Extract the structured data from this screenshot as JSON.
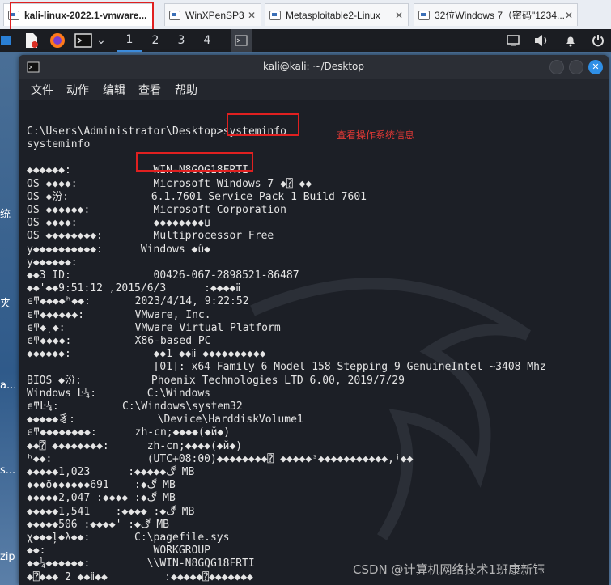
{
  "vmware_tabs": [
    {
      "label": "kali-linux-2022.1-vmware...",
      "active": true
    },
    {
      "label": "WinXPenSP3",
      "active": false
    },
    {
      "label": "Metasploitable2-Linux",
      "active": false
    },
    {
      "label": "32位Windows 7（密码\"1234...",
      "active": false
    }
  ],
  "panel": {
    "workspaces": [
      "1",
      "2",
      "3",
      "4"
    ],
    "active_workspace": "1",
    "icons": [
      "app-menu-icon",
      "file-icon",
      "firefox-icon",
      "terminal-icon",
      "chevron-down-icon",
      "window-icon",
      "volume-icon",
      "bell-icon",
      "power-icon"
    ]
  },
  "desktop_labels": [
    "统",
    "夹",
    "a...",
    "s...",
    "zip"
  ],
  "terminal": {
    "title": "kali@kali: ~/Desktop",
    "menu": [
      "文件",
      "动作",
      "编辑",
      "查看",
      "帮助"
    ],
    "prompt": "C:\\Users\\Administrator\\Desktop>",
    "command": "systeminfo",
    "lines": [
      "systeminfo",
      "",
      "◆◆◆◆◆◆:             WIN-N8GQG18FRTI",
      "OS ◆◆◆◆:            Microsoft Windows 7 ◆⍰ ◆◆",
      "OS ◆汾:             6.1.7601 Service Pack 1 Build 7601",
      "OS ◆◆◆◆◆◆:          Microsoft Corporation",
      "OS ◆◆◆◆:            ◆◆◆◆◆◆◆◆џ",
      "OS ◆◆◆◆◆◆◆◆:        Multiprocessor Free",
      "у◆◆◆◆◆◆◆◆◆◆:      Windows ◆û◆",
      "у◆◆◆◆◆◆:",
      "◆◆3 ID:             00426-067-2898521-86487",
      "◆◆'◆◆9:51:12 ,2015/6/3      :◆◆◆◆ⅱ",
      "ϵͳ◆◆◆◆ʰ◆◆:       2023/4/14, 9:22:52",
      "ϵͳ◆◆◆◆◆◆:        VMware, Inc.",
      "ϵͳ◆ͺ◆:           VMware Virtual Platform",
      "ϵͳ◆◆◆◆:          X86-based PC",
      "◆◆◆◆◆◆:             ◆◆1 ◆◆ⅱ ◆◆◆◆◆◆◆◆◆◆",
      "                    [01]: x64 Family 6 Model 158 Stepping 9 GenuineIntel ~3408 Mhz",
      "BIOS ◆汾:           Phoenix Technologies LTD 6.00, 2019/7/29",
      "Windows Ŀ¼:        C:\\Windows",
      "ϵͳĿ¼:          C:\\Windows\\system32",
      "◆◆◆◆◆豸:             \\Device\\HarddiskVolume1",
      "ϵͳ◆◆◆◆◆◆◆◆:      zh-cn;◆◆◆◆(◆й◆)",
      "◆◆⍰ ◆◆◆◆◆◆◆◆:      zh-cn;◆◆◆◆(◆й◆)",
      "ʰ◆◆:               (UTC+08:00)◆◆◆◆◆◆◆◆⍰ ◆◆◆◆◆ᵌ◆◆◆◆◆◆◆◆◆◆◆,ʲ◆◆",
      "◆◆◆◆◆1,023      :◆◆◆◆◆ڰ MB",
      "◆◆◆õ◆◆◆◆◆◆691    :◆ڰ MB",
      "◆◆◆◆◆2,047 :◆◆◆◆ :◆ڰ MB",
      "◆◆◆◆◆1,541    :◆◆◆◆ :◆ڰ MB",
      "◆◆◆◆◆506 :◆◆◆◆' :◆ڰ MB",
      "χ◆◆◆ļ◆λ◆◆:       C:\\pagefile.sys",
      "◆◆:                 WORKGROUP",
      "◆◆¼◆◆◆◆◆◆:         \\\\WIN-N8GQG18FRTI",
      "◆⍰◆◆◆ 2 ◆◆ⅱ◆◆         :◆◆◆◆◆⍰◆◆◆◆◆◆◆"
    ]
  },
  "annotation": "查看操作系统信息",
  "watermark": "CSDN @计算机网络技术1班康新钰",
  "colors": {
    "highlight_red": "#e02020",
    "annotation_red": "#e53935",
    "kali_panel": "#1b1d22",
    "terminal_bg": "#1c1f26"
  }
}
